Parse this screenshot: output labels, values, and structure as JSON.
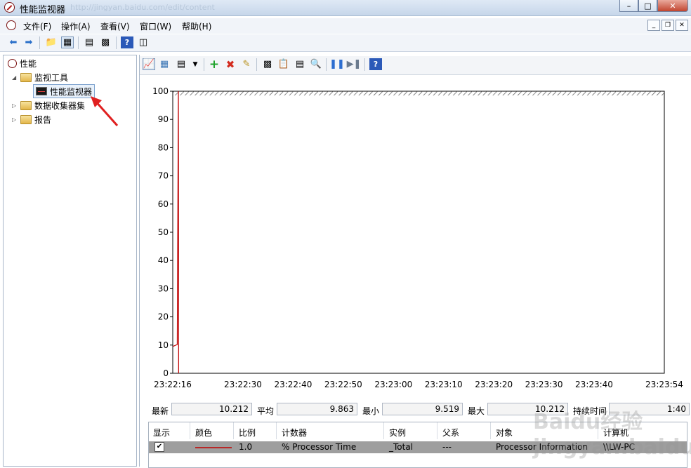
{
  "window": {
    "title": "性能监视器",
    "faded_url": "http://jingyan.baidu.com/edit/content"
  },
  "menu": [
    "文件(F)",
    "操作(A)",
    "查看(V)",
    "窗口(W)",
    "帮助(H)"
  ],
  "tree": {
    "root": "性能",
    "monitoring_tools": "监视工具",
    "perf_monitor": "性能监视器",
    "data_collector_sets": "数据收集器集",
    "reports": "报告"
  },
  "chart_data": {
    "type": "line",
    "ylim": [
      0,
      100
    ],
    "yticks": [
      "100",
      "90",
      "80",
      "70",
      "60",
      "50",
      "40",
      "30",
      "20",
      "10",
      "0"
    ],
    "xticks": [
      "23:22:16",
      "23:22:30",
      "23:22:40",
      "23:22:50",
      "23:23:00",
      "23:23:10",
      "23:23:20",
      "23:23:30",
      "23:23:40",
      "23:23:54"
    ],
    "series": [
      {
        "name": "% Processor Time",
        "color": "#c00000",
        "points": [
          [
            0,
            9.5
          ],
          [
            2,
            10.2
          ],
          [
            2.5,
            100
          ],
          [
            2.6,
            0
          ]
        ]
      }
    ]
  },
  "stats": {
    "last_label": "最新",
    "last_value": "10.212",
    "avg_label": "平均",
    "avg_value": "9.863",
    "min_label": "最小",
    "min_value": "9.519",
    "max_label": "最大",
    "max_value": "10.212",
    "duration_label": "持续时间",
    "duration_value": "1:40"
  },
  "counter_table": {
    "headers": [
      "显示",
      "颜色",
      "比例",
      "计数器",
      "实例",
      "父系",
      "对象",
      "计算机"
    ],
    "row": {
      "show": "✔",
      "color": "#c00000",
      "scale": "1.0",
      "counter": "% Processor Time",
      "instance": "_Total",
      "parent": "---",
      "object": "Processor Information",
      "computer": "\\\\LW-PC"
    }
  },
  "watermark": "Baidu经验 jingyan.baidu.com"
}
